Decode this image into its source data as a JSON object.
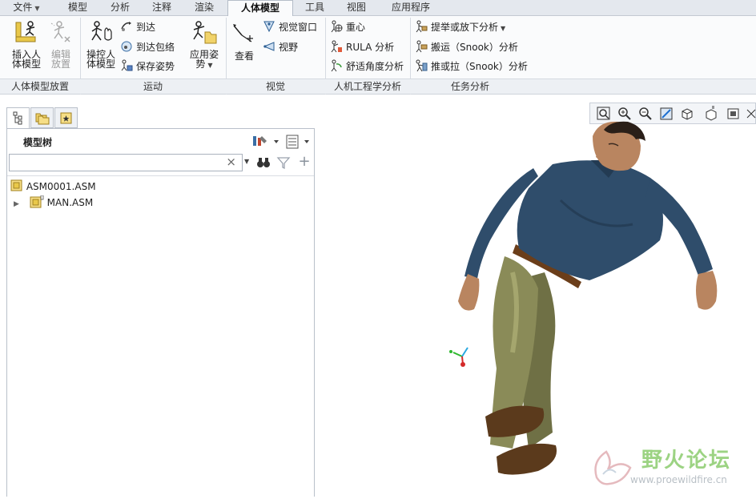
{
  "tabs": [
    {
      "label": "文件",
      "has_menu": true
    },
    {
      "label": "模型"
    },
    {
      "label": "分析"
    },
    {
      "label": "注释"
    },
    {
      "label": "渲染"
    },
    {
      "label": "人体模型",
      "active": true
    },
    {
      "label": "工具"
    },
    {
      "label": "视图"
    },
    {
      "label": "应用程序"
    }
  ],
  "ribbon": {
    "groups": {
      "placement": "人体模型放置",
      "motion": "运动",
      "vision": "视觉",
      "ergonomics": "人机工程学分析",
      "task": "任务分析"
    },
    "insert_line1": "插入人",
    "insert_line2": "体模型",
    "edit_line1": "编辑",
    "edit_line2": "放置",
    "manipulate_line1": "操控人",
    "manipulate_line2": "体模型",
    "reach": "到达",
    "reach_envelope": "到达包络",
    "save_posture": "保存姿势",
    "apply_line1": "应用姿",
    "apply_line2": "势",
    "view": "查看",
    "vision_window": "视觉窗口",
    "field_of_view": "视野",
    "center_of_gravity": "重心",
    "rula": "RULA 分析",
    "comfort_angle": "舒适角度分析",
    "lift_lower": "提举或放下分析",
    "carry": "搬运（Snook）分析",
    "push_pull": "推或拉（Snook）分析"
  },
  "model_tree": {
    "title": "模型树",
    "search_value": "",
    "clear_symbol": "×",
    "items": [
      {
        "label": "ASM0001.ASM"
      },
      {
        "label": "MAN.ASM"
      }
    ]
  },
  "watermark": {
    "title": "野火论坛",
    "url": "www.proewildfire.cn"
  },
  "colors": {
    "accent": "#1e6fd0",
    "shirt": "#2f4d6b",
    "pants": "#8a8b58",
    "shoes": "#5b3a1c",
    "skin": "#b98560",
    "watermark_green": "#7cc55a"
  }
}
